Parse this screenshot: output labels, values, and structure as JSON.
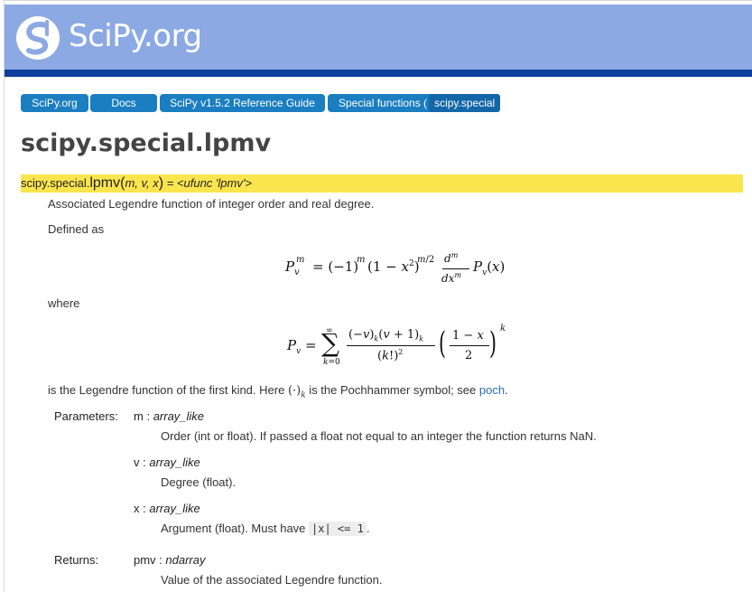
{
  "header": {
    "logo_text": "SciPy.org"
  },
  "breadcrumbs": [
    {
      "label": "SciPy.org"
    },
    {
      "label": "Docs"
    },
    {
      "label": "SciPy v1.5.2 Reference Guide"
    },
    {
      "label_prefix": "Special functions (",
      "label_inner": "scipy.special",
      "label_suffix": ")"
    }
  ],
  "page": {
    "title": "scipy.special.lpmv",
    "signature": {
      "module": "scipy.special.",
      "name": "lpmv",
      "open": "(",
      "args": "m, v, x",
      "close": ")",
      "rest": " = <ufunc 'lpmv'>"
    },
    "summary": "Associated Legendre function of integer order and real degree.",
    "defined_as": "Defined as",
    "where": "where",
    "legendre_text_1": "is the Legendre function of the first kind. Here ",
    "legendre_text_2": " is the Pochhammer symbol; see ",
    "legendre_link": "poch",
    "legendre_text_3": "."
  },
  "parameters": {
    "label": "Parameters:",
    "items": [
      {
        "name": "m",
        "sep": " : ",
        "type": "array_like",
        "desc": "Order (int or float). If passed a float not equal to an integer the function returns NaN."
      },
      {
        "name": "v",
        "sep": " : ",
        "type": "array_like",
        "desc": "Degree (float)."
      },
      {
        "name": "x",
        "sep": " : ",
        "type": "array_like",
        "desc_prefix": "Argument (float). Must have ",
        "desc_code": "|x| <= 1",
        "desc_suffix": "."
      }
    ]
  },
  "returns": {
    "label": "Returns:",
    "name": "pmv",
    "sep": " : ",
    "type": "ndarray",
    "desc": "Value of the associated Legendre function."
  },
  "colors": {
    "header_bg": "#8ca9e3",
    "header_bar": "#0f3e9c",
    "crumb_bg": "#1a7ec1",
    "signature_bg": "#fbe54e",
    "link": "#2a6fba"
  }
}
